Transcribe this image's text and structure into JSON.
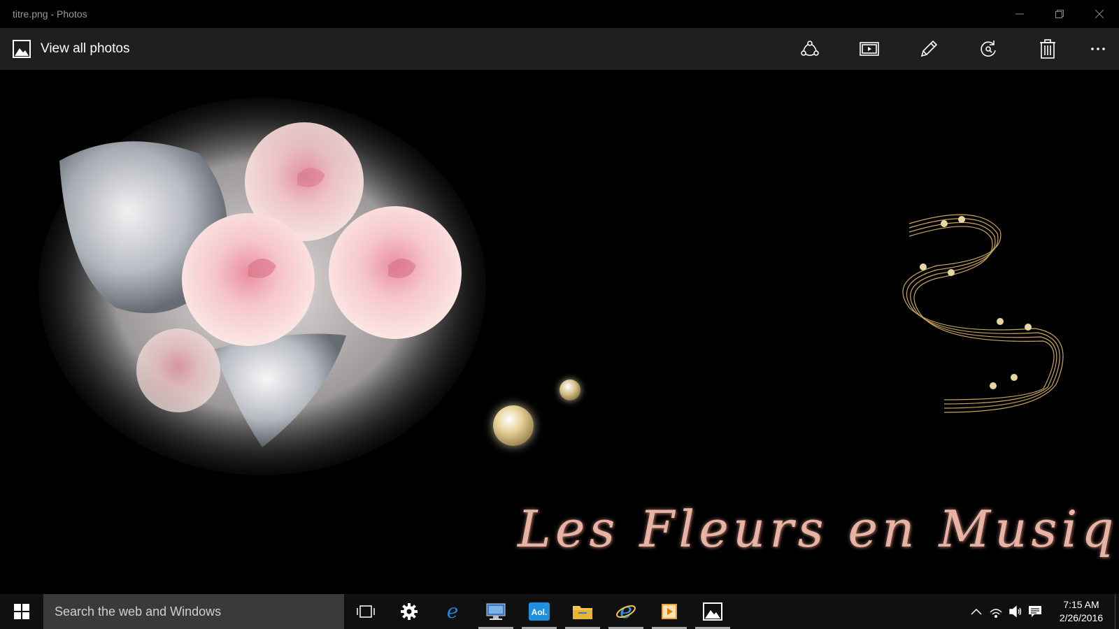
{
  "window": {
    "title": "titre.png - Photos",
    "controls": [
      "minimize-icon",
      "restore-icon",
      "close-icon"
    ]
  },
  "appbar": {
    "view_all_label": "View all photos",
    "actions": [
      {
        "name": "share-icon"
      },
      {
        "name": "slideshow-icon"
      },
      {
        "name": "edit-icon"
      },
      {
        "name": "rotate-icon"
      },
      {
        "name": "delete-icon"
      },
      {
        "name": "more-icon"
      }
    ]
  },
  "image": {
    "caption": "Les Fleurs en Musique",
    "colors": {
      "rose": "#f3c3c8",
      "silver": "#d9dde2",
      "gold": "#c8a55a"
    }
  },
  "taskbar": {
    "search_placeholder": "Search the web and Windows",
    "apps": [
      {
        "name": "task-view-icon",
        "open": false
      },
      {
        "name": "settings-icon",
        "open": false
      },
      {
        "name": "edge-icon",
        "open": false
      },
      {
        "name": "remote-desktop-icon",
        "open": true
      },
      {
        "name": "aol-icon",
        "open": true,
        "text": "Aol."
      },
      {
        "name": "file-explorer-icon",
        "open": true
      },
      {
        "name": "internet-explorer-icon",
        "open": true
      },
      {
        "name": "media-player-icon",
        "open": true
      },
      {
        "name": "photos-icon",
        "open": true
      }
    ],
    "time": "7:15 AM",
    "date": "2/26/2016"
  }
}
